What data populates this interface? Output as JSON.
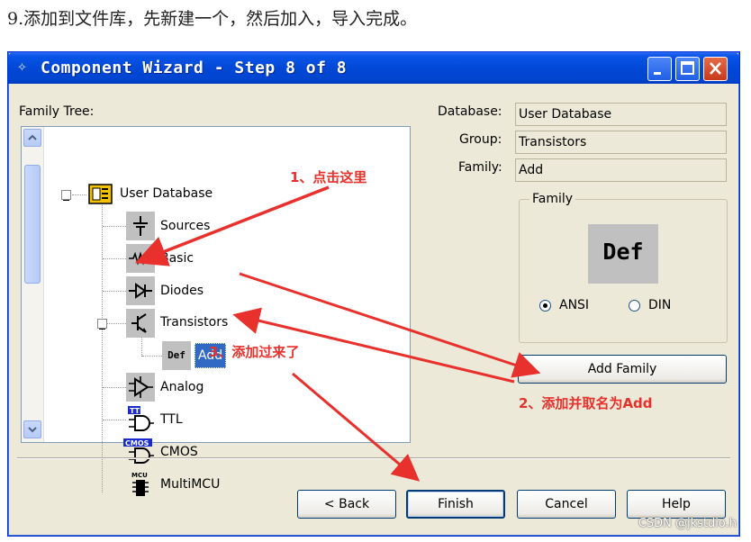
{
  "caption": "9.添加到文件库，先新建一个，然后加入，导入完成。",
  "window": {
    "title": "Component Wizard - Step 8 of 8"
  },
  "tree": {
    "label": "Family Tree:",
    "root": "User Database",
    "items": [
      {
        "label": "Sources",
        "icon": "sources-icon"
      },
      {
        "label": "Basic",
        "icon": "basic-icon"
      },
      {
        "label": "Diodes",
        "icon": "diode-icon"
      },
      {
        "label": "Transistors",
        "icon": "transistor-icon"
      },
      {
        "label": "Analog",
        "icon": "opamp-icon"
      },
      {
        "label": "TTL",
        "icon": "ttl-gate-icon"
      },
      {
        "label": "CMOS",
        "icon": "cmos-gate-icon"
      },
      {
        "label": "MultiMCU",
        "icon": "mcu-chip-icon"
      }
    ],
    "child": {
      "icon_text": "Def",
      "label": "Add"
    }
  },
  "fields": {
    "database_label": "Database:",
    "database_value": "User Database",
    "group_label": "Group:",
    "group_value": "Transistors",
    "family_label": "Family:",
    "family_value": "Add"
  },
  "family_box": {
    "title": "Family",
    "symbol_text": "Def",
    "options": [
      {
        "label": "ANSI",
        "selected": true
      },
      {
        "label": "DIN",
        "selected": false
      }
    ]
  },
  "buttons": {
    "add_family": "Add Family",
    "back": "< Back",
    "finish": "Finish",
    "cancel": "Cancel",
    "help": "Help"
  },
  "annotations": {
    "step1": "1、点击这里",
    "step2": "2、添加并取名为Add",
    "step3": "3、添加过来了",
    "color": "#e8302c"
  },
  "watermark": "CSDN @jkstdio.h"
}
